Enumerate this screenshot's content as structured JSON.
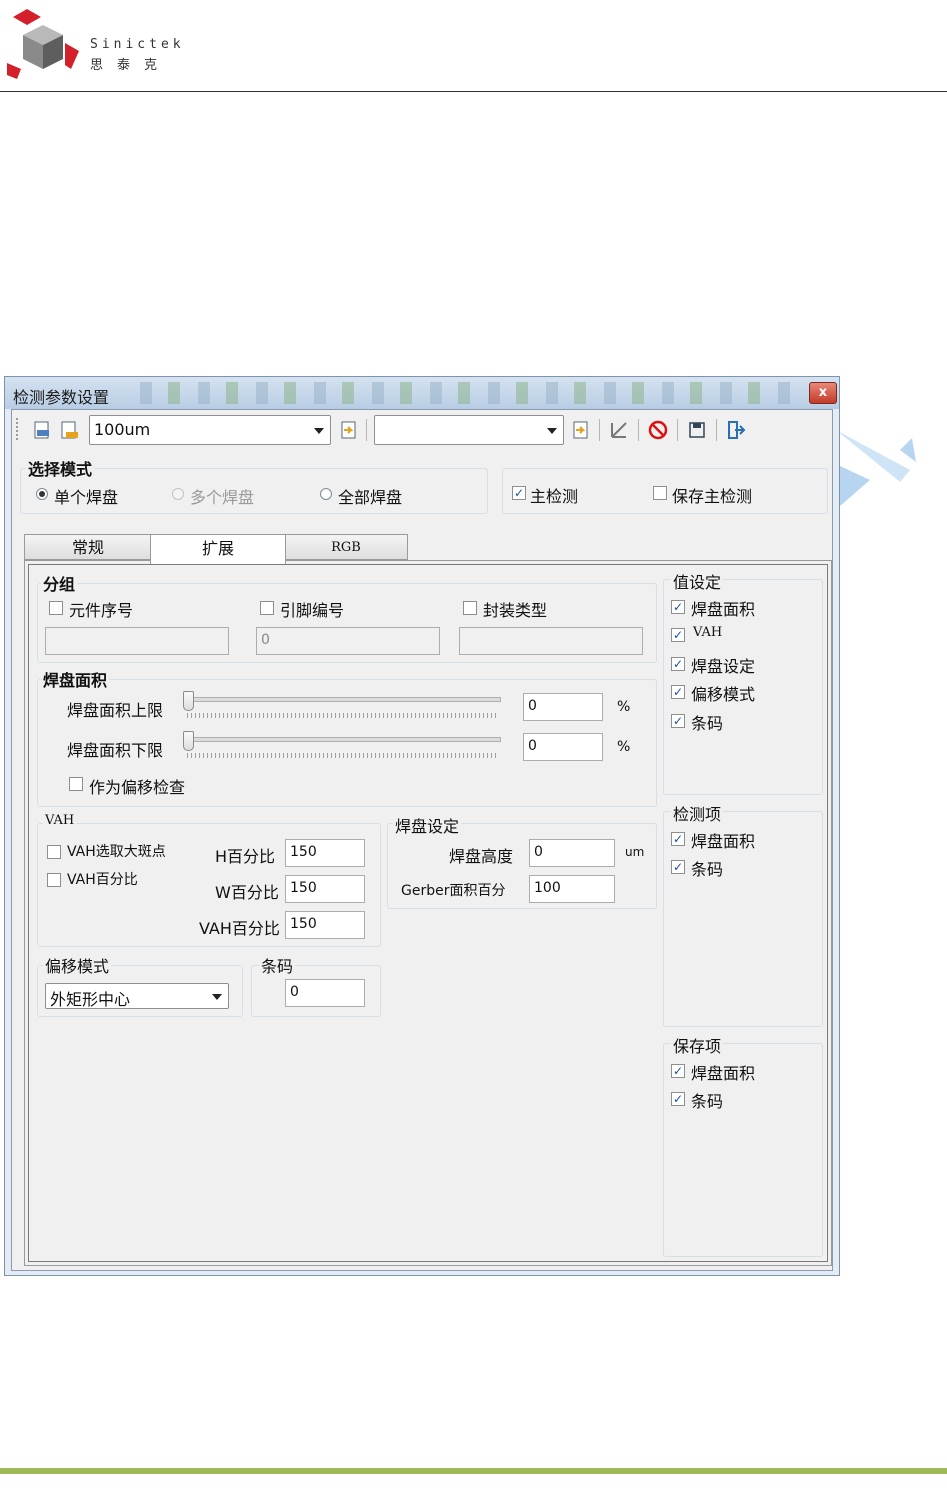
{
  "brand": {
    "name_en": "Sinictek",
    "name_cn": "思泰克"
  },
  "window": {
    "title": "检测参数设置",
    "close_label": "x",
    "toolbar": {
      "combo1_value": "100um",
      "combo2_value": ""
    }
  },
  "mode": {
    "group_label": "选择模式",
    "options": [
      {
        "label": "单个焊盘",
        "selected": true,
        "enabled": true
      },
      {
        "label": "多个焊盘",
        "selected": false,
        "enabled": false
      },
      {
        "label": "全部焊盘",
        "selected": false,
        "enabled": true
      }
    ],
    "main_detect_label": "主检测",
    "main_detect_checked": true,
    "save_main_label": "保存主检测",
    "save_main_checked": false
  },
  "tabs": [
    {
      "label": "常规",
      "active": false
    },
    {
      "label": "扩展",
      "active": true
    },
    {
      "label": "RGB",
      "active": false
    }
  ],
  "grouping": {
    "label": "分组",
    "items": [
      {
        "label": "元件序号",
        "checked": false,
        "value": ""
      },
      {
        "label": "引脚编号",
        "checked": false,
        "value": "0"
      },
      {
        "label": "封装类型",
        "checked": false,
        "value": ""
      }
    ]
  },
  "pad_area": {
    "label": "焊盘面积",
    "upper_label": "焊盘面积上限",
    "upper_value": "0",
    "lower_label": "焊盘面积下限",
    "lower_value": "0",
    "unit": "%",
    "offset_check_label": "作为偏移检查",
    "offset_check_checked": false,
    "upper_slider_level": 0,
    "lower_slider_level": 0
  },
  "vah": {
    "label": "VAH",
    "select_spot_label": "VAH选取大斑点",
    "select_spot_checked": false,
    "percent_label": "VAH百分比",
    "percent_checked": false,
    "h_label": "H百分比",
    "h_value": "150",
    "w_label": "W百分比",
    "w_value": "150",
    "vah_label": "VAH百分比",
    "vah_value": "150"
  },
  "pad_setting": {
    "label": "焊盘设定",
    "height_label": "焊盘高度",
    "height_value": "0",
    "height_unit": "um",
    "gerber_label": "Gerber面积百分",
    "gerber_value": "100"
  },
  "offset_mode": {
    "label": "偏移模式",
    "value": "外矩形中心"
  },
  "barcode": {
    "label": "条码",
    "value": "0"
  },
  "value_setting": {
    "label": "值设定",
    "items": [
      {
        "label": "焊盘面积",
        "checked": true
      },
      {
        "label": "VAH",
        "checked": true
      },
      {
        "label": "焊盘设定",
        "checked": true
      },
      {
        "label": "偏移模式",
        "checked": true
      },
      {
        "label": "条码",
        "checked": true
      }
    ]
  },
  "detect_items": {
    "label": "检测项",
    "items": [
      {
        "label": "焊盘面积",
        "checked": true
      },
      {
        "label": "条码",
        "checked": true
      }
    ]
  },
  "save_items": {
    "label": "保存项",
    "items": [
      {
        "label": "焊盘面积",
        "checked": true
      },
      {
        "label": "条码",
        "checked": true
      }
    ]
  },
  "colors": {
    "accent_green": "#9bbb59",
    "title_bar": "#c6d7ea",
    "check_blue": "#1e4f9c"
  }
}
